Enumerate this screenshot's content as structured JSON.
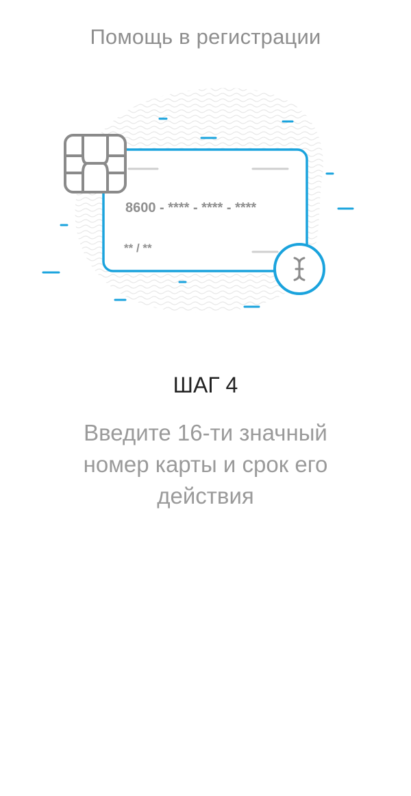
{
  "header": {
    "title": "Помощь в регистрации"
  },
  "illustration": {
    "card_number": "8600 - **** - **** - ****",
    "card_expiry": "** / **",
    "icons": [
      "card-chip-icon",
      "text-cursor-icon"
    ]
  },
  "step": {
    "title": "ШАГ 4",
    "description": "Введите 16-ти значный номер карты и срок его действия"
  },
  "colors": {
    "accent": "#1aa3dd",
    "chip_gray": "#8a8a8a",
    "title_gray": "#8e8e8e",
    "text_dark": "#222222",
    "text_light": "#9a9a9a"
  }
}
